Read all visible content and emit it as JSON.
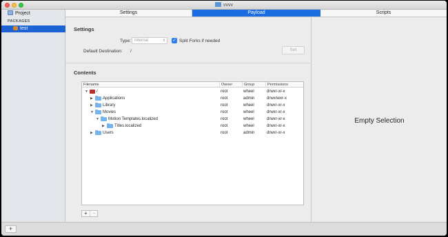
{
  "window": {
    "title": "vvvv"
  },
  "sidebar": {
    "project_label": "Project",
    "packages_header": "PACKAGES",
    "selected_package": "test"
  },
  "tabs": [
    {
      "label": "Settings"
    },
    {
      "label": "Payload",
      "selected": true
    },
    {
      "label": "Scripts"
    }
  ],
  "settings": {
    "title": "Settings",
    "type_label": "Type:",
    "type_value": "Internal",
    "split_forks_label": "Split Forks if needed",
    "split_forks_checked": true,
    "default_destination_label": "Default Destination:",
    "default_destination_value": "/",
    "set_button": "Set"
  },
  "contents": {
    "title": "Contents",
    "columns": [
      "Filename",
      "Owner",
      "Group",
      "Permissions"
    ],
    "rows": [
      {
        "name": "/",
        "owner": "root",
        "group": "wheel",
        "perm": "drwxr-xr-x"
      },
      {
        "name": "Applications",
        "owner": "root",
        "group": "admin",
        "perm": "drwxrwxr-x"
      },
      {
        "name": "Library",
        "owner": "root",
        "group": "wheel",
        "perm": "drwxr-xr-x"
      },
      {
        "name": "Movies",
        "owner": "root",
        "group": "wheel",
        "perm": "drwxr-xr-x"
      },
      {
        "name": "Motion Templates.localized",
        "owner": "root",
        "group": "wheel",
        "perm": "drwxr-xr-x"
      },
      {
        "name": "Titles.localized",
        "owner": "root",
        "group": "wheel",
        "perm": "drwxr-xr-x"
      },
      {
        "name": "Users",
        "owner": "root",
        "group": "admin",
        "perm": "drwxr-xr-x"
      }
    ],
    "add_label": "+",
    "remove_label": "−"
  },
  "inspector": {
    "empty_text": "Empty Selection"
  },
  "bottombar": {
    "add_label": "+"
  },
  "colors": {
    "accent": "#1a6ce0",
    "folder": "#74b3ec"
  }
}
